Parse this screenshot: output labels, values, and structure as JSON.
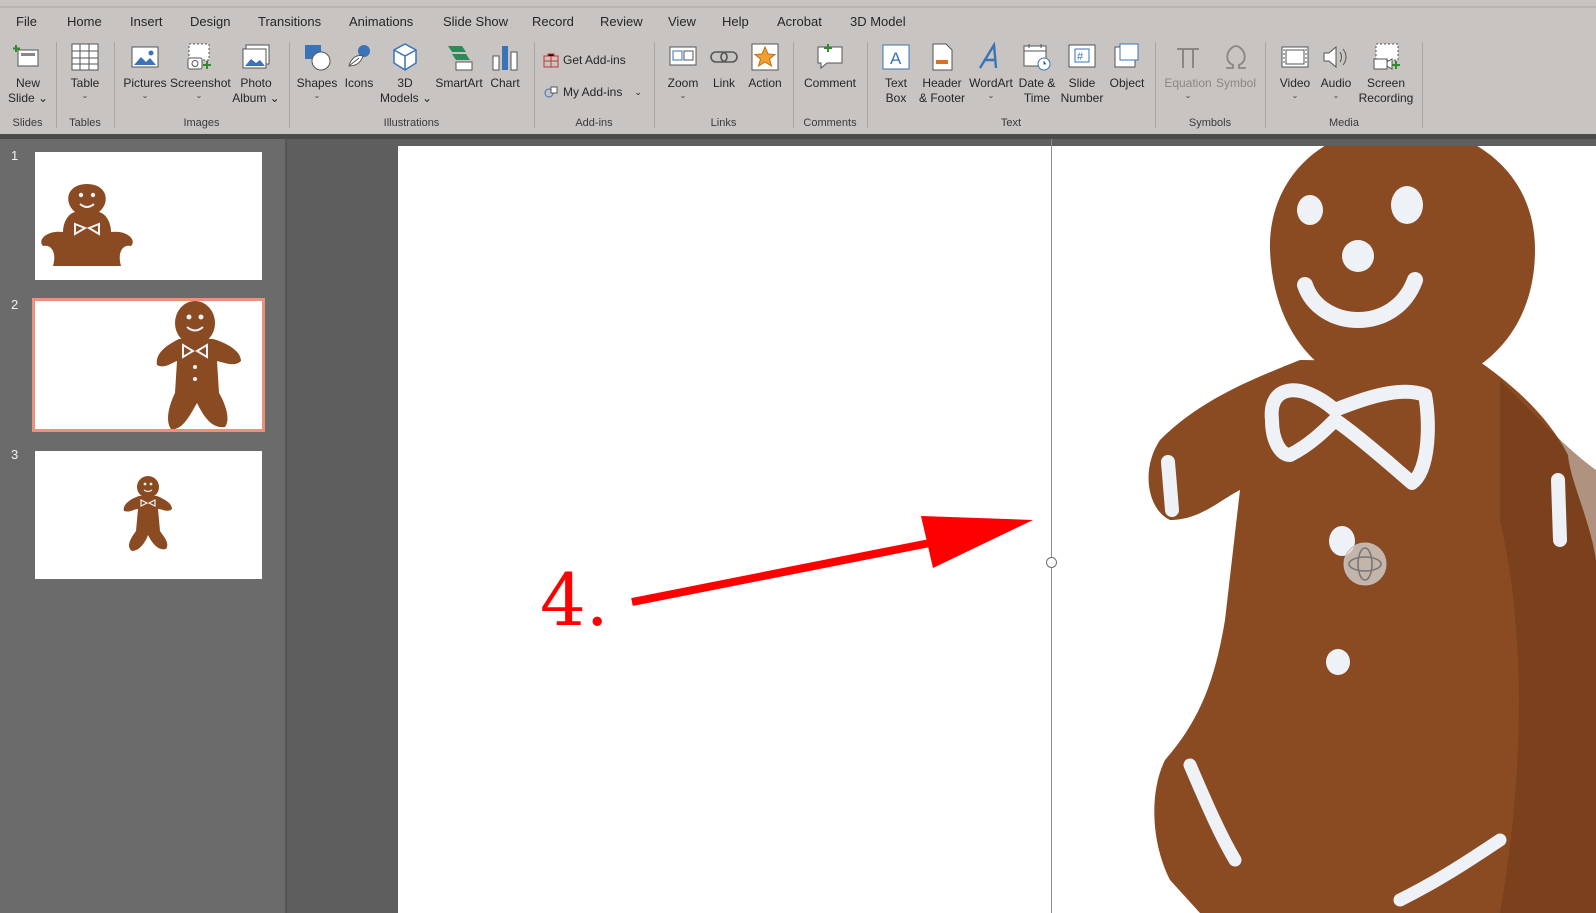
{
  "menu_tabs": [
    {
      "label": "File"
    },
    {
      "label": "Home"
    },
    {
      "label": "Insert",
      "active": true
    },
    {
      "label": "Design"
    },
    {
      "label": "Transitions"
    },
    {
      "label": "Animations"
    },
    {
      "label": "Slide Show"
    },
    {
      "label": "Record"
    },
    {
      "label": "Review"
    },
    {
      "label": "View"
    },
    {
      "label": "Help"
    },
    {
      "label": "Acrobat"
    },
    {
      "label": "3D Model"
    }
  ],
  "ribbon": {
    "groups": {
      "slides": "Slides",
      "tables": "Tables",
      "images": "Images",
      "illustrations": "Illustrations",
      "addins": "Add-ins",
      "links": "Links",
      "comments": "Comments",
      "text": "Text",
      "symbols": "Symbols",
      "media": "Media"
    },
    "buttons": {
      "new_slide_1": "New",
      "new_slide_2": "Slide",
      "table": "Table",
      "pictures": "Pictures",
      "screenshot": "Screenshot",
      "photo_album_1": "Photo",
      "photo_album_2": "Album",
      "shapes": "Shapes",
      "icons": "Icons",
      "models_1": "3D",
      "models_2": "Models",
      "smartart": "SmartArt",
      "chart": "Chart",
      "get_addins": "Get Add-ins",
      "my_addins": "My Add-ins",
      "zoom": "Zoom",
      "link": "Link",
      "action": "Action",
      "comment": "Comment",
      "text_box_1": "Text",
      "text_box_2": "Box",
      "header_1": "Header",
      "header_2": "& Footer",
      "wordart": "WordArt",
      "date_1": "Date &",
      "date_2": "Time",
      "slide_number_1": "Slide",
      "slide_number_2": "Number",
      "object": "Object",
      "equation": "Equation",
      "symbol": "Symbol",
      "video": "Video",
      "audio": "Audio",
      "screen_rec_1": "Screen",
      "screen_rec_2": "Recording"
    }
  },
  "thumbnails": [
    {
      "number": "1"
    },
    {
      "number": "2",
      "selected": true
    },
    {
      "number": "3"
    }
  ],
  "annotation": {
    "text": "4.",
    "color": "#ff0000"
  },
  "colors": {
    "ribbon_bg": "#c8c4c1",
    "selected_thumb_outline": "#e8917c",
    "gingerbread": "#8a4a22",
    "icing": "#eef2f6"
  }
}
